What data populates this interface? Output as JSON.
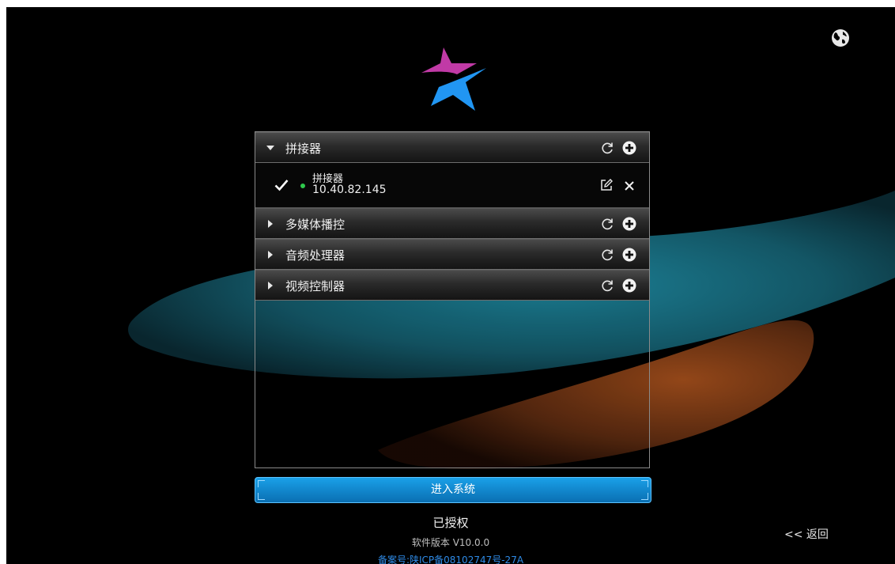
{
  "colors": {
    "background": "#000000",
    "accent_blue": "#1a9be3",
    "status_online": "#2ec84c",
    "icp_link": "#2e8ae6",
    "teal_band": "#1b7c92",
    "orange_band": "#7a3a14",
    "logo_magenta": "#c13aa6",
    "logo_blue": "#2196f3"
  },
  "icons": {
    "globe": "globe-icon",
    "logo": "star-logo",
    "refresh": "refresh-icon",
    "add": "plus-circle-icon",
    "edit": "edit-icon",
    "delete": "close-icon",
    "check": "check-icon",
    "expand": "caret-icon"
  },
  "groups": [
    {
      "title": "拼接器",
      "expanded": true,
      "devices": [
        {
          "name": "拼接器",
          "ip": "10.40.82.145",
          "selected": true,
          "online": true
        }
      ]
    },
    {
      "title": "多媒体播控",
      "expanded": false
    },
    {
      "title": "音频处理器",
      "expanded": false
    },
    {
      "title": "视频控制器",
      "expanded": false
    }
  ],
  "enter_button": "进入系统",
  "auth_status": "已授权",
  "version": "软件版本 V10.0.0",
  "icp": "备案号:陕ICP备08102747号-27A",
  "back": "<< 返回"
}
